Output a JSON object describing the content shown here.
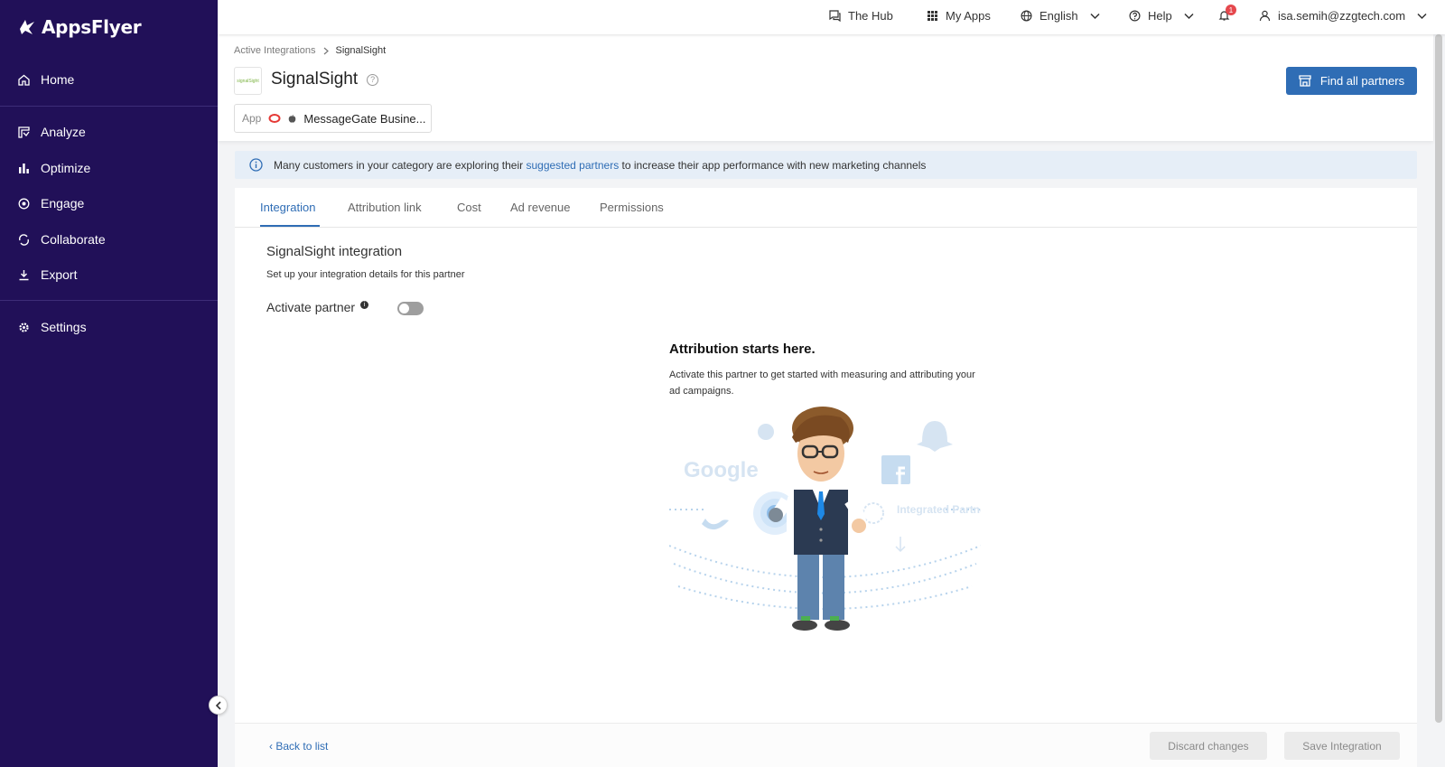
{
  "sidebar": {
    "brand": "AppsFlyer",
    "items": [
      {
        "label": "Home",
        "icon": "home-icon"
      },
      {
        "label": "Analyze",
        "icon": "analyze-icon"
      },
      {
        "label": "Optimize",
        "icon": "optimize-icon"
      },
      {
        "label": "Engage",
        "icon": "engage-icon"
      },
      {
        "label": "Collaborate",
        "icon": "collaborate-icon"
      },
      {
        "label": "Export",
        "icon": "export-icon"
      },
      {
        "label": "Settings",
        "icon": "settings-icon"
      }
    ]
  },
  "topbar": {
    "hub": "The Hub",
    "my_apps": "My Apps",
    "language": "English",
    "help": "Help",
    "notifications_count": "1",
    "user": "isa.semih@zzgtech.com"
  },
  "header": {
    "breadcrumb": {
      "parent": "Active Integrations",
      "current": "SignalSight"
    },
    "partner_logo_text": "signalSight",
    "partner_name": "SignalSight",
    "app_label": "App",
    "app_name": "MessageGate Busine...",
    "find_partners": "Find all partners"
  },
  "banner": {
    "text_before": "Many customers in your category are exploring their",
    "link": "suggested partners",
    "text_after": "to increase their app performance with new marketing channels"
  },
  "tabs": [
    "Integration",
    "Attribution link",
    "Cost",
    "Ad revenue",
    "Permissions"
  ],
  "integration": {
    "title": "SignalSight integration",
    "subtitle": "Set up your integration details for this partner",
    "activate_label": "Activate partner",
    "activated": false
  },
  "empty_state": {
    "title": "Attribution starts here.",
    "description": "Activate this partner to get started with measuring and attributing your ad campaigns.",
    "illustration_google": "Google",
    "illustration_partners": "Integrated Partners"
  },
  "footer": {
    "back": "Back to list",
    "discard": "Discard changes",
    "save": "Save Integration"
  },
  "colors": {
    "sidebar": "#211058",
    "accent": "#2f6db5",
    "banner": "#e6eef7"
  }
}
